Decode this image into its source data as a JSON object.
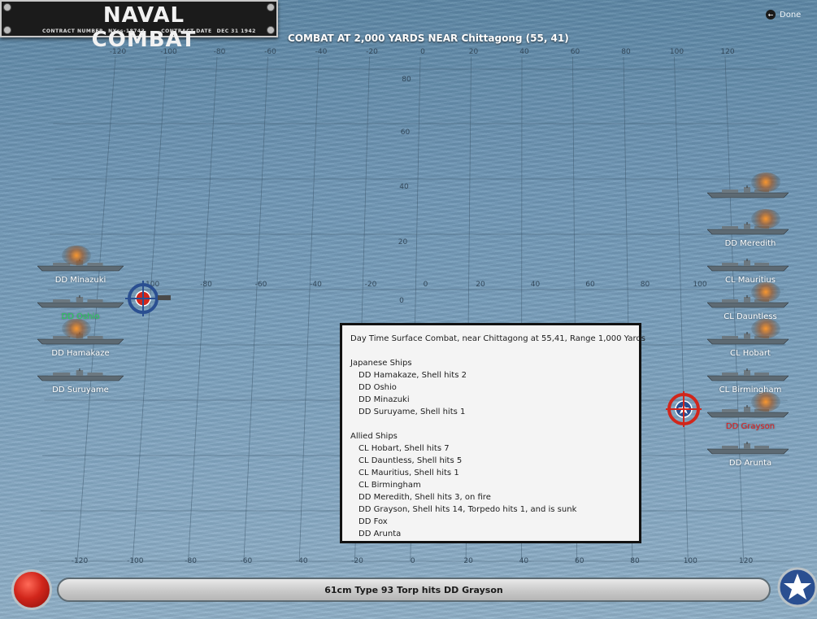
{
  "title_plate": {
    "title": "NAVAL COMBAT",
    "contract_number_label": "CONTRACT NUMBER",
    "contract_number": "NXss-18743",
    "contract_date_label": "CONTRACT DATE",
    "contract_date": "DEC 31 1942"
  },
  "header": {
    "title": "COMBAT AT 2,000 YARDS NEAR Chittagong (55, 41)"
  },
  "done_button": {
    "label": "Done",
    "icon": "back-arrow-icon"
  },
  "grid": {
    "top_ticks": [
      "-120",
      "-100",
      "-80",
      "-60",
      "-40",
      "-20",
      "0",
      "20",
      "40",
      "60",
      "80",
      "100",
      "120"
    ],
    "bottom_ticks": [
      "-120",
      "-100",
      "-80",
      "-60",
      "-40",
      "-20",
      "0",
      "20",
      "40",
      "60",
      "80",
      "100",
      "120"
    ],
    "middle_ticks": [
      "-100",
      "-80",
      "-60",
      "-40",
      "-20",
      "0",
      "20",
      "40",
      "60",
      "80",
      "100"
    ],
    "left_ticks": [
      "80",
      "60",
      "40",
      "20",
      "0",
      "-20",
      "-40",
      "-60",
      "-80"
    ],
    "right_ticks": [
      "80",
      "60",
      "40",
      "20",
      "0",
      "-20",
      "-40",
      "-60",
      "-80"
    ]
  },
  "japanese_ships": [
    {
      "label": "DD Minazuki",
      "status": "damaged",
      "smoke": true
    },
    {
      "label": "DD Oshio",
      "status": "hidden",
      "smoke": false
    },
    {
      "label": "DD Hamakaze",
      "status": "damaged",
      "smoke": true
    },
    {
      "label": "DD Suruyame",
      "status": "ok",
      "smoke": false
    }
  ],
  "allied_ships": [
    {
      "label": "",
      "status": "damaged",
      "smoke": true
    },
    {
      "label": "DD Meredith",
      "status": "damaged",
      "smoke": true
    },
    {
      "label": "CL Mauritius",
      "status": "ok",
      "smoke": false
    },
    {
      "label": "CL Dauntless",
      "status": "damaged",
      "smoke": true
    },
    {
      "label": "CL Hobart",
      "status": "damaged",
      "smoke": true
    },
    {
      "label": "CL Birmingham",
      "status": "damaged",
      "smoke": false
    },
    {
      "label": "DD Grayson",
      "status": "sunk",
      "smoke": true
    },
    {
      "label": "DD Arunta",
      "status": "ok",
      "smoke": false
    }
  ],
  "report": {
    "heading": "Day Time Surface Combat, near Chittagong at 55,41, Range 1,000 Yards",
    "japanese_header": "Japanese Ships",
    "japanese_lines": [
      "DD Hamakaze, Shell hits 2",
      "DD Oshio",
      "DD Minazuki",
      "DD Suruyame, Shell hits 1"
    ],
    "allied_header": "Allied Ships",
    "allied_lines": [
      "CL Hobart, Shell hits 7",
      "CL Dauntless, Shell hits 5",
      "CL Mauritius, Shell hits 1",
      "CL Birmingham",
      "DD Meredith, Shell hits 3,  on fire",
      "DD Grayson, Shell hits 14, Torpedo hits 1, and is sunk",
      "DD Fox",
      "DD Arunta"
    ]
  },
  "status_bar": {
    "message": "61cm Type 93 Torp hits DD Grayson"
  },
  "colors": {
    "sea": "#6f97b6",
    "sunk_label": "#e31d1d",
    "hidden_label": "#27d35a",
    "jp_button": "#d1261b",
    "us_button": "#2a4f91"
  }
}
